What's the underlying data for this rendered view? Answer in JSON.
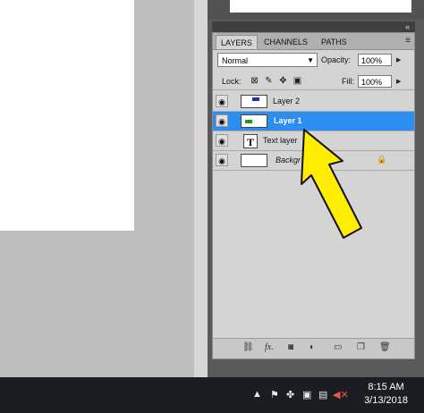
{
  "panel": {
    "tabs": [
      "LAYERS",
      "CHANNELS",
      "PATHS"
    ],
    "collapse_icon": "«",
    "menu_icon": "≡",
    "blend_mode": "Normal",
    "opacity_label": "Opacity:",
    "opacity_value": "100%",
    "lock_label": "Lock:",
    "fill_label": "Fill:",
    "fill_value": "100%"
  },
  "layers": [
    {
      "name": "Layer 2"
    },
    {
      "name": "Layer 1",
      "selected": true
    },
    {
      "name": "Text layer"
    },
    {
      "name": "Backgr"
    }
  ],
  "taskbar": {
    "time": "8:15 AM",
    "date": "3/13/2018"
  },
  "colors": {
    "selection": "#2c8ef0",
    "arrow": "#ffee00"
  }
}
